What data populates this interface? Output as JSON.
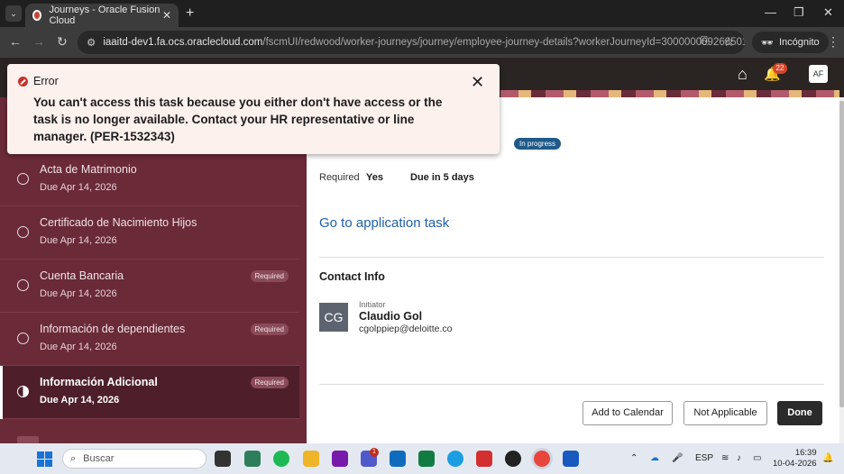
{
  "browser": {
    "tab_title": "Journeys - Oracle Fusion Cloud",
    "url_host": "iaaitd-dev1.fa.ocs.oraclecloud.com",
    "url_path": "/fscmUI/redwood/worker-journeys/journey/employee-journey-details?workerJourneyId=300000009268501...",
    "incognito_label": "Incógnito"
  },
  "header": {
    "notification_count": "22",
    "user_initials": "AF"
  },
  "error": {
    "title": "Error",
    "message": "You can't access this task because you either don't have access or the task is no longer available. Contact your HR representative or line manager. (PER-1532343)"
  },
  "tasks": [
    {
      "title": "Acta de Matrimonio",
      "due": "Due Apr 14, 2026",
      "required": ""
    },
    {
      "title": "Certificado de Nacimiento Hijos",
      "due": "Due Apr 14, 2026",
      "required": ""
    },
    {
      "title": "Cuenta Bancaria",
      "due": "Due Apr 14, 2026",
      "required": "Required"
    },
    {
      "title": "Información de dependientes",
      "due": "Due Apr 14, 2026",
      "required": "Required"
    },
    {
      "title": "Información Adicional",
      "due": "Due Apr 14, 2026",
      "required": "Required"
    }
  ],
  "detail": {
    "status_badge": "In progress",
    "required_label": "Required",
    "required_value": "Yes",
    "due_value": "Due in 5 days",
    "app_task_link": "Go to application task",
    "contact_heading": "Contact Info",
    "contact_initials": "CG",
    "contact_role": "Initiator",
    "contact_name": "Claudio Gol",
    "contact_email": "cgolppiep@deloitte.co"
  },
  "actions": {
    "add_calendar": "Add to Calendar",
    "not_applicable": "Not Applicable",
    "done": "Done"
  },
  "taskbar": {
    "search_placeholder": "Buscar",
    "teams_badge": "1",
    "language": "ESP",
    "time": "16:39",
    "date": "10-04-2026"
  }
}
